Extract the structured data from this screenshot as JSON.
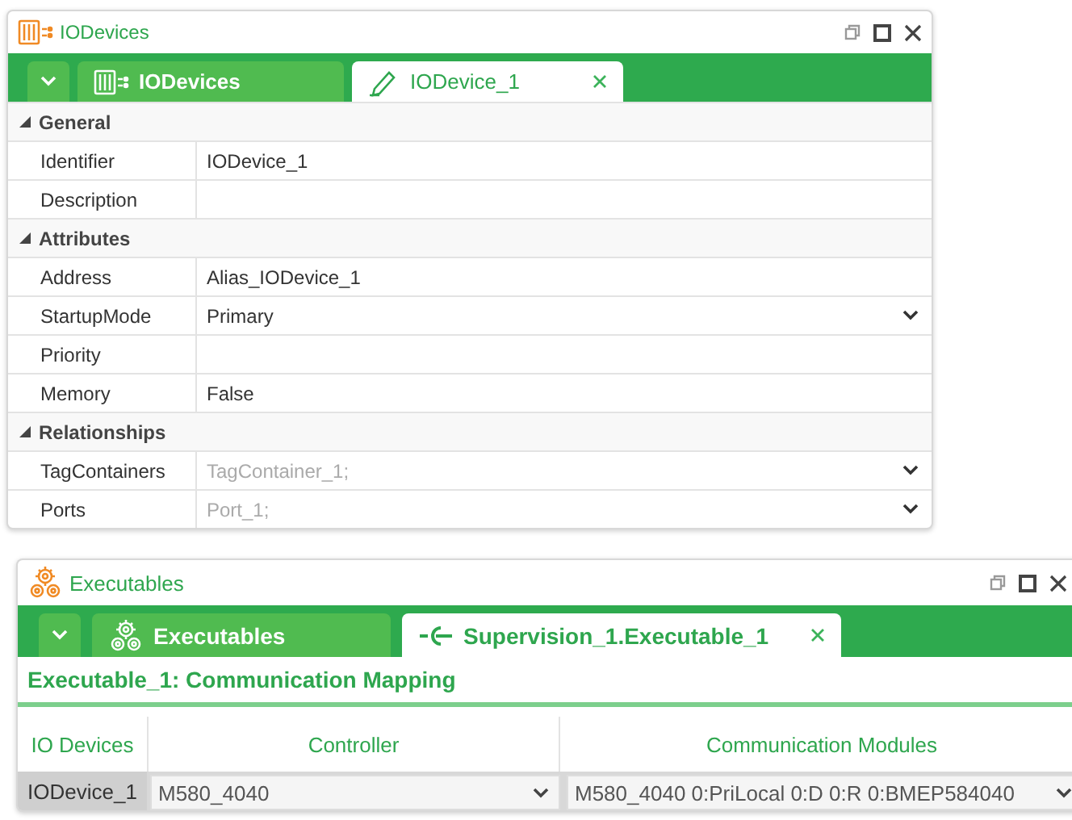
{
  "iodevices_window": {
    "title": "IODevices",
    "tabs": [
      {
        "kind": "dropdown",
        "selected": false
      },
      {
        "kind": "list",
        "label": "IODevices",
        "selected": false
      },
      {
        "kind": "editor",
        "label": "IODevice_1",
        "selected": true
      }
    ],
    "sections": [
      {
        "title": "General",
        "expanded": true,
        "rows": [
          {
            "label": "Identifier",
            "value": "IODevice_1",
            "kind": "text"
          },
          {
            "label": "Description",
            "kind": "text"
          }
        ]
      },
      {
        "title": "Attributes",
        "expanded": true,
        "rows": [
          {
            "label": "Address",
            "value": "Alias_IODevice_1",
            "kind": "text"
          },
          {
            "label": "StartupMode",
            "value": "Primary",
            "kind": "dropdown"
          },
          {
            "label": "Priority",
            "kind": "text"
          },
          {
            "label": "Memory",
            "value": "False",
            "kind": "text"
          }
        ]
      },
      {
        "title": "Relationships",
        "expanded": true,
        "rows": [
          {
            "label": "TagContainers",
            "value": "TagContainer_1;",
            "kind": "dropdown",
            "muted": true
          },
          {
            "label": "Ports",
            "value": "Port_1;",
            "kind": "dropdown",
            "muted": true
          }
        ]
      }
    ]
  },
  "executables_window": {
    "title": "Executables",
    "tabs": [
      {
        "kind": "dropdown",
        "selected": false
      },
      {
        "kind": "list",
        "label": "Executables",
        "selected": false
      },
      {
        "kind": "mapping",
        "label": "Supervision_1.Executable_1",
        "selected": true
      }
    ],
    "heading": "Executable_1: Communication Mapping",
    "table": {
      "columns": [
        "IO Devices",
        "Controller",
        "Communication Modules"
      ],
      "rows": [
        {
          "io_device": "IODevice_1",
          "controller": "M580_4040",
          "communication_module": "M580_4040 0:PriLocal 0:D 0:R 0:BMEP584040"
        }
      ]
    }
  }
}
